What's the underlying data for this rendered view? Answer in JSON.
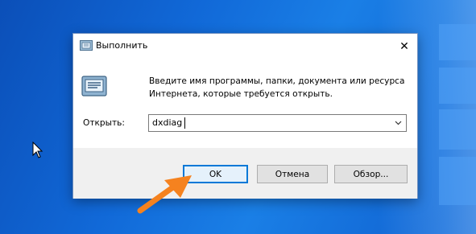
{
  "dialog": {
    "title": "Выполнить",
    "description": "Введите имя программы, папки, документа или ресурса Интернета, которые требуется открыть.",
    "open_label": "Открыть:",
    "input_value": "dxdiag",
    "close_glyph": "✕"
  },
  "buttons": {
    "ok": "OK",
    "cancel": "Отмена",
    "browse": "Обзор..."
  },
  "icons": [
    "run-icon",
    "close-icon",
    "chevron-down-icon",
    "mouse-cursor-icon",
    "pointer-arrow-icon"
  ],
  "colors": {
    "desktop": "#1169d8",
    "accent": "#0078d7",
    "annotation_arrow": "#f5821f",
    "footer": "#f0f0f0"
  }
}
